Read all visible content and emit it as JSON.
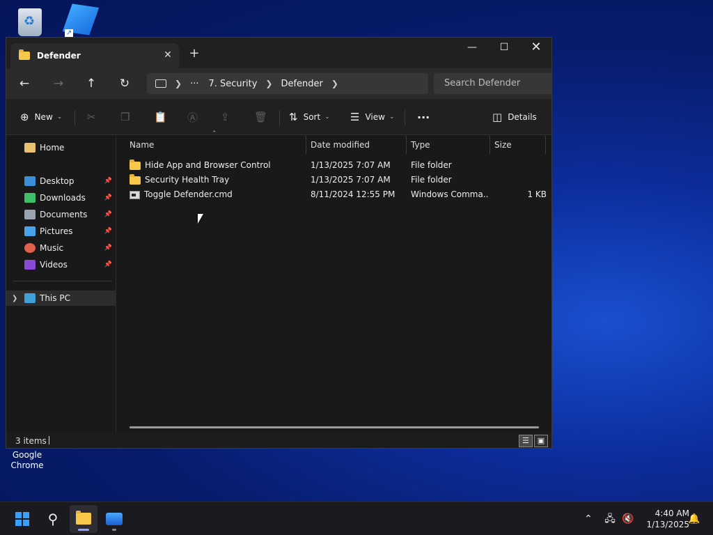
{
  "desktop": {
    "chrome_label_line1": "Google",
    "chrome_label_line2": "Chrome"
  },
  "window": {
    "tab_title": "Defender",
    "new_tab": "+",
    "controls": {
      "minimize": "—",
      "maximize": "☐",
      "close": "✕"
    }
  },
  "nav": {
    "breadcrumb": [
      "7. Security",
      "Defender"
    ],
    "overflow": "···",
    "search_placeholder": "Search Defender"
  },
  "commands": {
    "new": "New",
    "sort": "Sort",
    "view": "View",
    "more": "···",
    "details": "Details"
  },
  "sidebar": {
    "home": "Home",
    "quick_access": [
      {
        "label": "Desktop",
        "color": "#3b8fd8"
      },
      {
        "label": "Downloads",
        "color": "#3fbf6a"
      },
      {
        "label": "Documents",
        "color": "#9aa4b0"
      },
      {
        "label": "Pictures",
        "color": "#4aa3e8"
      },
      {
        "label": "Music",
        "color": "#e0604a"
      },
      {
        "label": "Videos",
        "color": "#8a4ad8"
      }
    ],
    "this_pc": "This PC"
  },
  "columns": {
    "name": "Name",
    "date": "Date modified",
    "type": "Type",
    "size": "Size"
  },
  "files": [
    {
      "name": "Hide App and Browser Control",
      "date": "1/13/2025 7:07 AM",
      "type": "File folder",
      "size": "",
      "kind": "folder"
    },
    {
      "name": "Security Health Tray",
      "date": "1/13/2025 7:07 AM",
      "type": "File folder",
      "size": "",
      "kind": "folder"
    },
    {
      "name": "Toggle Defender.cmd",
      "date": "8/11/2024 12:55 PM",
      "type": "Windows Comma...",
      "size": "1 KB",
      "kind": "cmd"
    }
  ],
  "status": {
    "count": "3 items"
  },
  "taskbar": {
    "time": "4:40 AM",
    "date": "1/13/2025"
  }
}
